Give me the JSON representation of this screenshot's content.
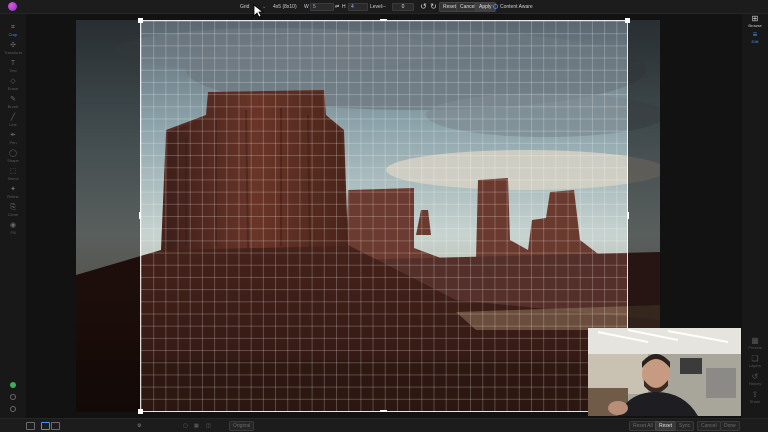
{
  "toolbar": {
    "grid_label": "Grid",
    "grid_value": "4x5 (8x10)",
    "width_label": "W",
    "width_value": "5",
    "height_label": "H",
    "height_value": "4",
    "level_label": "Level",
    "level_value": "0",
    "reset_label": "Reset",
    "cancel_label": "Cancel",
    "apply_label": "Apply",
    "content_aware_label": "Content Aware"
  },
  "left_tools": [
    {
      "label": "Crop",
      "icon": "crop-icon"
    },
    {
      "label": "Transform",
      "icon": "transform-icon"
    },
    {
      "label": "Text",
      "icon": "text-icon"
    },
    {
      "label": "Erase",
      "icon": "erase-icon"
    },
    {
      "label": "Brush",
      "icon": "brush-icon"
    },
    {
      "label": "Line",
      "icon": "line-icon"
    },
    {
      "label": "Pen",
      "icon": "pen-icon"
    },
    {
      "label": "Shape",
      "icon": "shape-icon"
    },
    {
      "label": "Select",
      "icon": "select-icon"
    },
    {
      "label": "Refine",
      "icon": "refine-icon"
    },
    {
      "label": "Clone",
      "icon": "clone-icon"
    },
    {
      "label": "Fill",
      "icon": "fill-icon"
    }
  ],
  "right_tools": [
    {
      "label": "Browse",
      "icon": "browse-icon"
    },
    {
      "label": "Edit",
      "icon": "edit-icon"
    },
    {
      "label": "Presets",
      "icon": "presets-icon"
    },
    {
      "label": "Layers",
      "icon": "layers-icon"
    },
    {
      "label": "History",
      "icon": "history-icon"
    },
    {
      "label": "Share",
      "icon": "share-icon"
    }
  ],
  "bottombar": {
    "original_label": "Original",
    "reset_all_label": "Reset All",
    "reset_label": "Reset",
    "sync_label": "Sync",
    "cancel_label": "Cancel",
    "done_label": "Done"
  },
  "colors": {
    "accent": "#4a8ff0",
    "chrome": "#1c1c1c",
    "sky": "#b7c7c9",
    "rock": "#5a2e24"
  }
}
